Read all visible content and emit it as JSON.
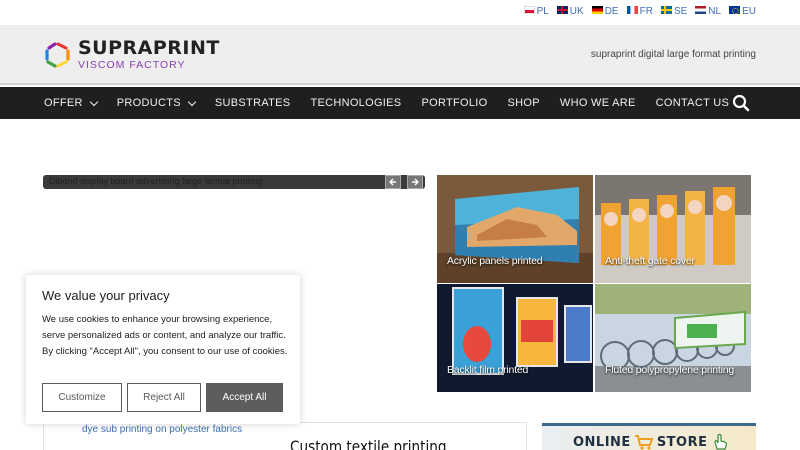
{
  "languages": [
    {
      "code": "PL",
      "flag": "pl-flag-icon"
    },
    {
      "code": "UK",
      "flag": "uk-flag-icon"
    },
    {
      "code": "DE",
      "flag": "de-flag-icon"
    },
    {
      "code": "FR",
      "flag": "fr-flag-icon"
    },
    {
      "code": "SE",
      "flag": "se-flag-icon"
    },
    {
      "code": "NL",
      "flag": "nl-flag-icon"
    },
    {
      "code": "EU",
      "flag": "eu-flag-icon"
    }
  ],
  "header": {
    "logo_name": "SUPRAPRINT",
    "logo_sub": "VISCOM FACTORY",
    "tagline": "supraprint digital large format printing"
  },
  "nav": {
    "items": [
      {
        "label": "OFFER",
        "dropdown": true
      },
      {
        "label": "PRODUCTS",
        "dropdown": true
      },
      {
        "label": "SUBSTRATES",
        "dropdown": false
      },
      {
        "label": "TECHNOLOGIES",
        "dropdown": false
      },
      {
        "label": "PORTFOLIO",
        "dropdown": false
      },
      {
        "label": "SHOP",
        "dropdown": false
      },
      {
        "label": "WHO WE ARE",
        "dropdown": false
      },
      {
        "label": "CONTACT US",
        "dropdown": false
      }
    ],
    "search_icon": "search-icon"
  },
  "slider": {
    "caption": "Dibond display board advertising large format printing"
  },
  "tiles": [
    {
      "label": "Acrylic panels printed"
    },
    {
      "label": "Anti-theft gate cover"
    },
    {
      "label": "Backlit film printed"
    },
    {
      "label": "Fluted polypropylene printing"
    }
  ],
  "cookie": {
    "title": "We value your privacy",
    "text": "We use cookies to enhance your browsing experience, serve personalized ads or content, and analyze our traffic. By clicking \"Accept All\", you consent to our use of cookies.",
    "customize": "Customize",
    "reject": "Reject All",
    "accept": "Accept All"
  },
  "content": {
    "link": "dye sub printing on polyester fabrics",
    "title": "Custom textile printing"
  },
  "store": {
    "label_left": "ONLINE",
    "label_right": "STORE"
  },
  "colors": {
    "nav_bg": "#1f1f1f",
    "header_bg": "#eeeeee",
    "link": "#3e6fb4",
    "logo_accent": "#8b3fb0",
    "accept_button": "#5d5d5d"
  }
}
